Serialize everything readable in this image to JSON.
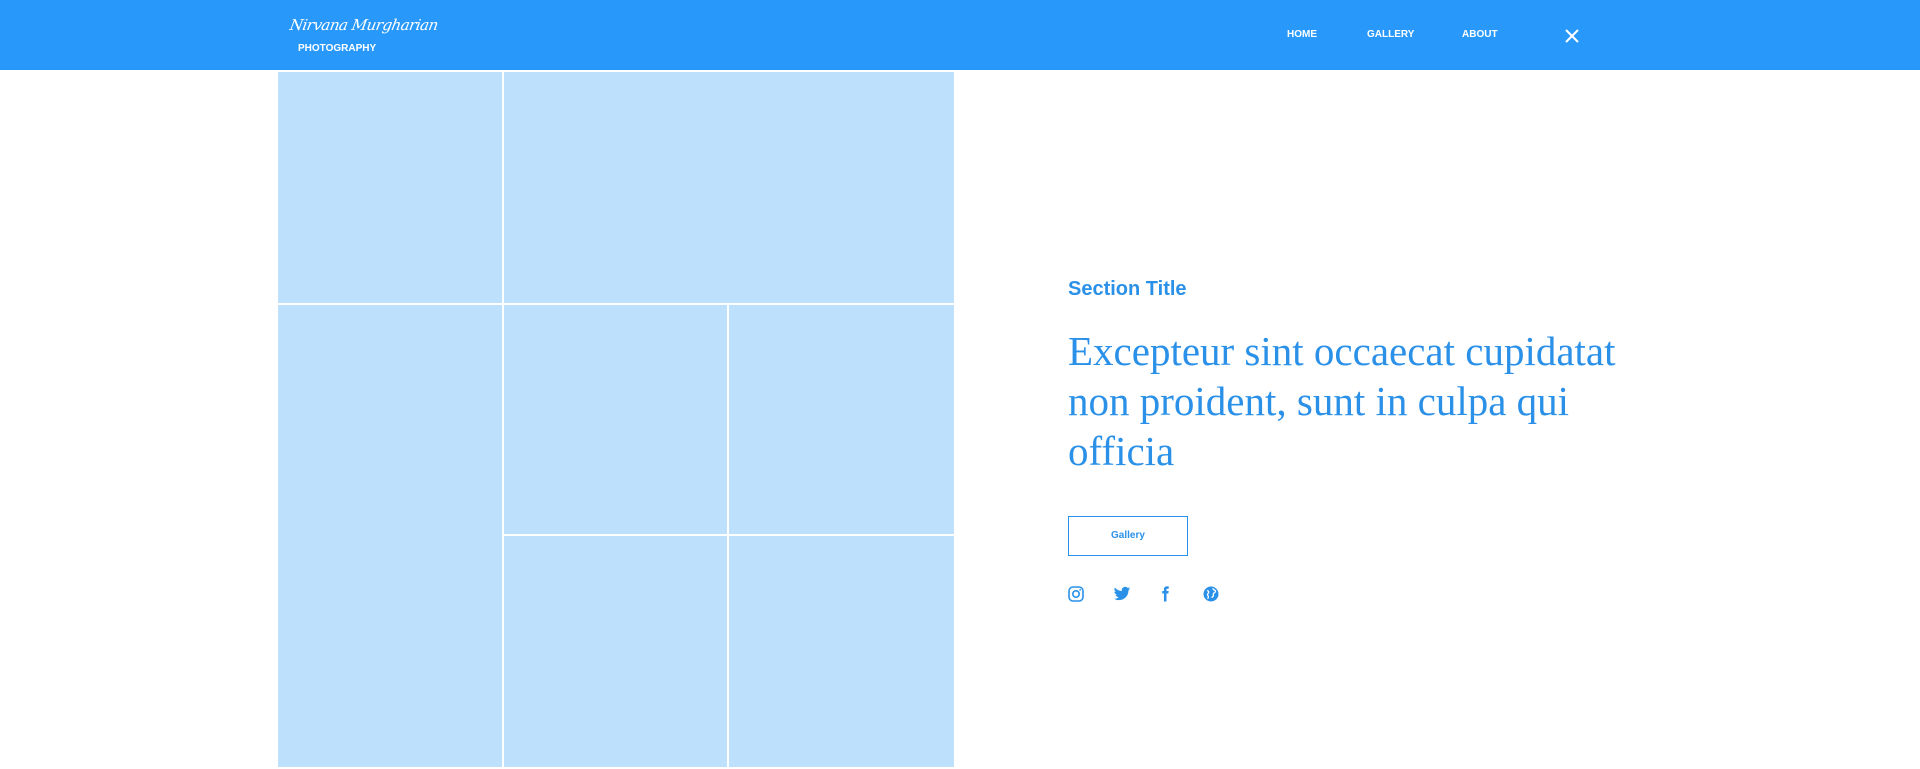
{
  "header": {
    "logo_script": "Nirvana Murgharian",
    "logo_sub": "PHOTOGRAPHY",
    "nav": {
      "home": "HOME",
      "gallery": "GALLERY",
      "about": "ABOUT"
    },
    "close_icon": "close-icon"
  },
  "gallery_grid": {
    "tile_count": 7
  },
  "content": {
    "section_title": "Section Title",
    "headline": "Excepteur sint occaecat cupidatat non proident, sunt in culpa qui officia",
    "button_label": "Gallery"
  },
  "social": [
    "instagram-icon",
    "twitter-icon",
    "facebook-icon",
    "globe-icon"
  ],
  "colors": {
    "primary": "#2899fb",
    "accent_text": "#2b91e8",
    "tile": "#bde0fd",
    "background": "#ffffff"
  }
}
